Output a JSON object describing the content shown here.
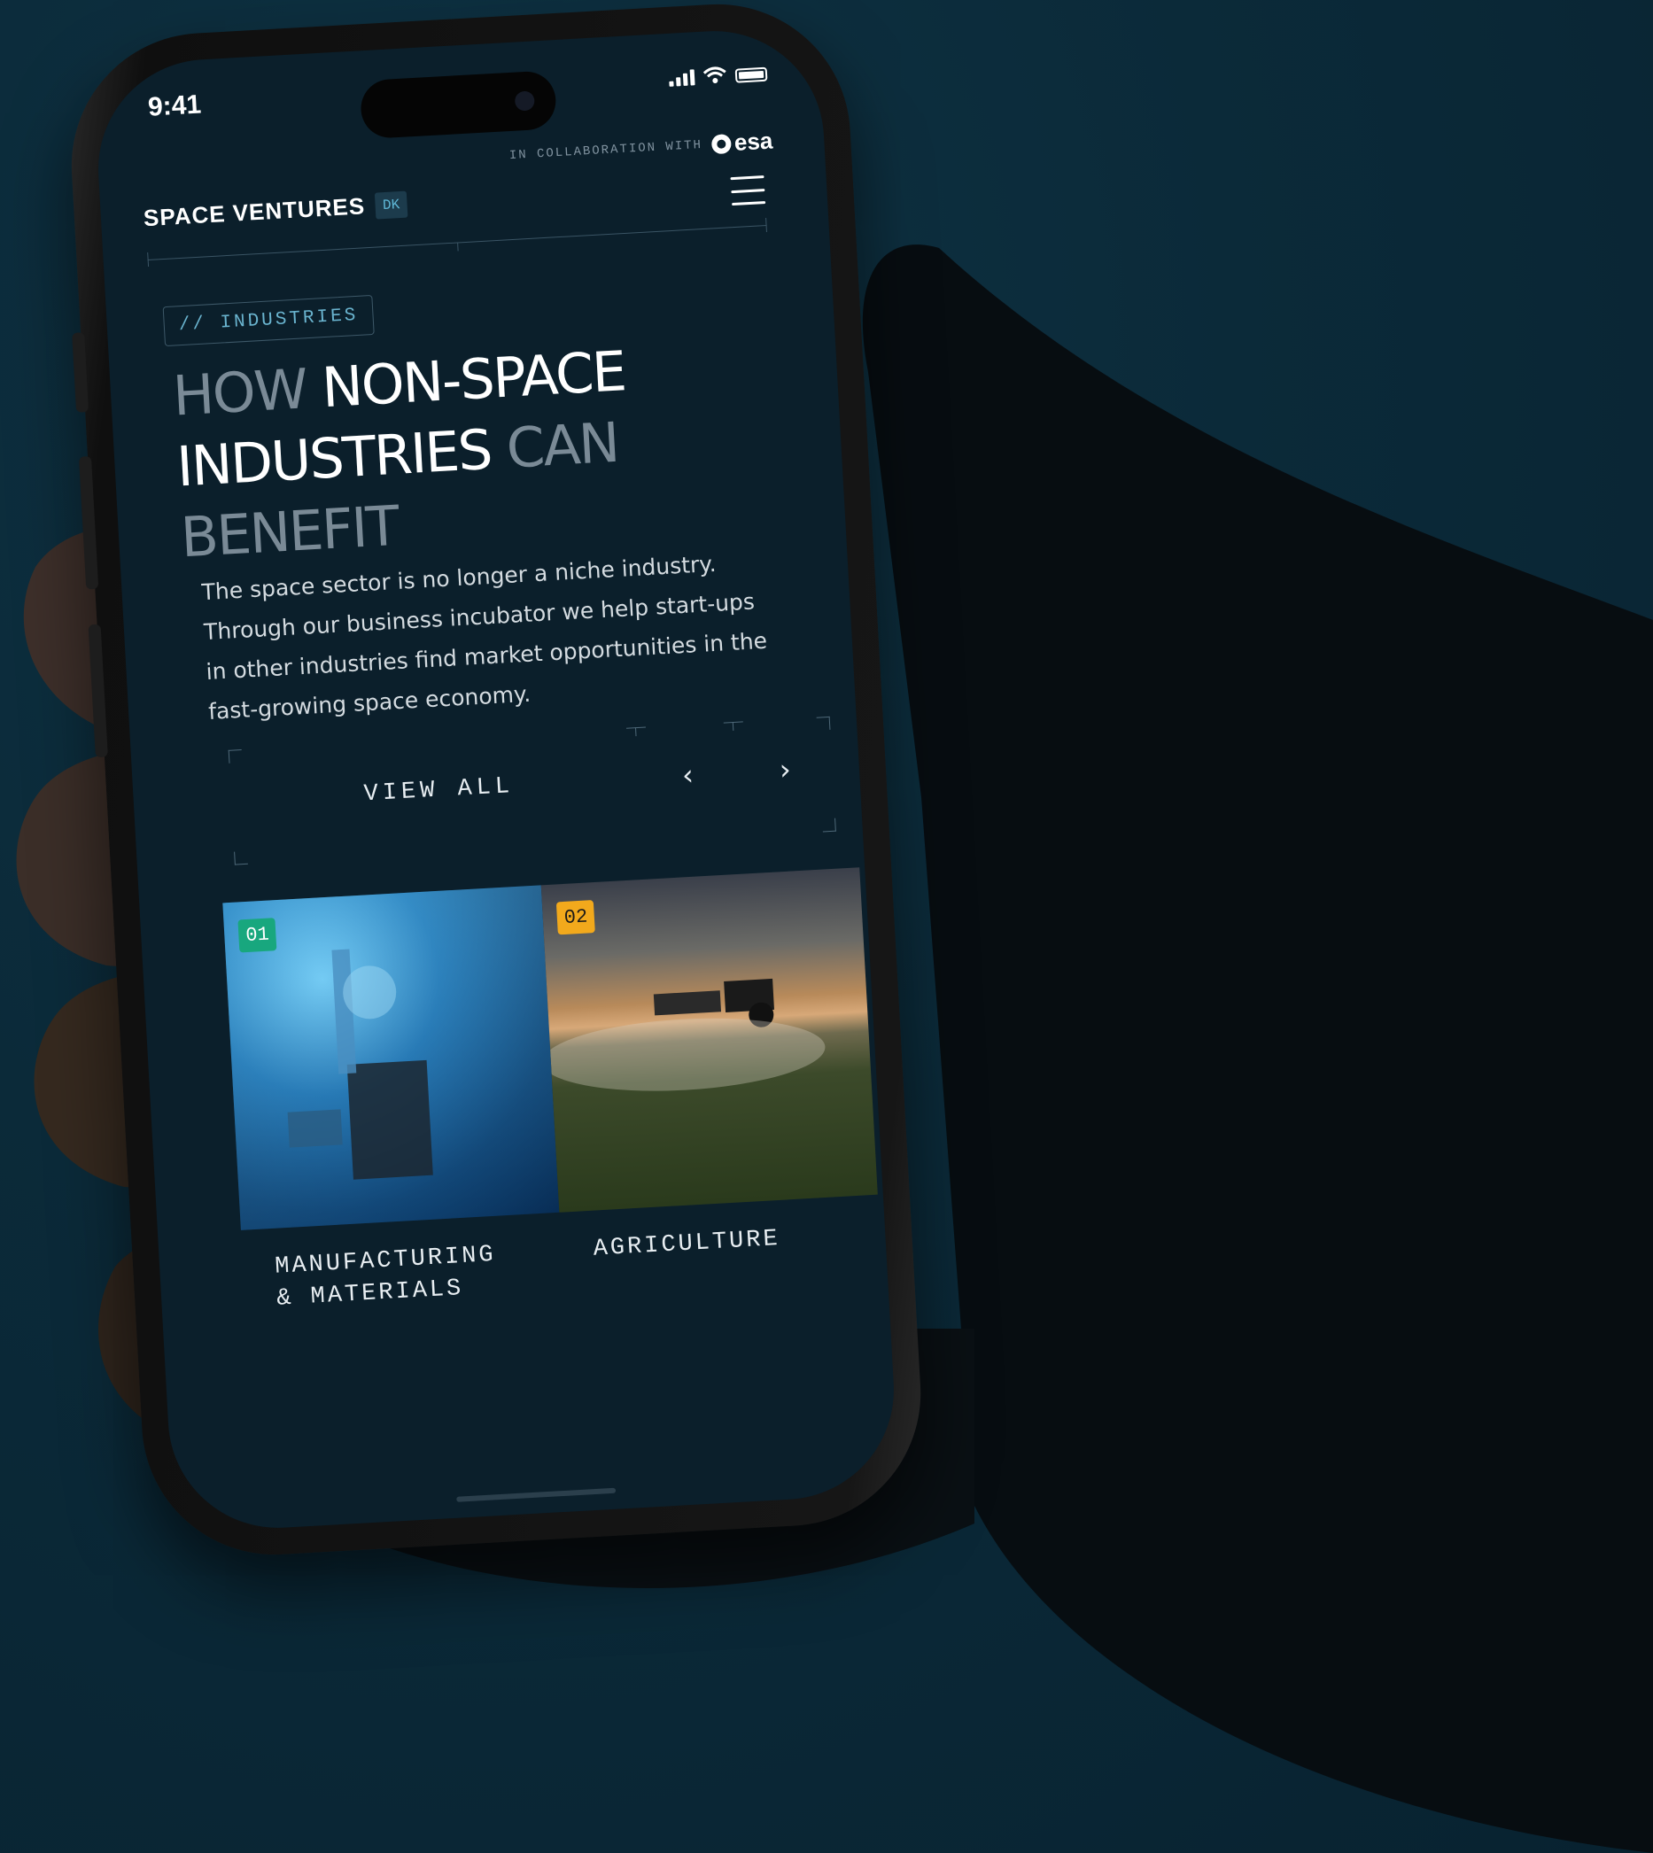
{
  "status_bar": {
    "time": "9:41"
  },
  "collaboration": {
    "text": "IN COLLABORATION WITH",
    "logo_text": "esa"
  },
  "brand": {
    "name": "SPACE VENTURES",
    "tag": "DK"
  },
  "section_badge": "// INDUSTRIES",
  "headline": {
    "part1_dim": "HOW ",
    "part2_bright": "NON-SPACE INDUSTRIES",
    "part3_dim": " CAN BENEFIT"
  },
  "body": "The space sector is no longer a niche industry. Through our business incubator we help start-ups in other industries find market opportunities in the fast-growing space economy.",
  "controls": {
    "view_all": "VIEW ALL",
    "prev_arrow": "‹",
    "next_arrow": "›"
  },
  "cards": [
    {
      "number": "01",
      "label": "MANUFACTURING\n& MATERIALS",
      "badge_color": "#18a77e"
    },
    {
      "number": "02",
      "label": "AGRICULTURE",
      "badge_color": "#f2a91c"
    }
  ],
  "colors": {
    "background": "#0b2a39",
    "screen": "#0b1f2b",
    "accent": "#6ab4cf"
  }
}
